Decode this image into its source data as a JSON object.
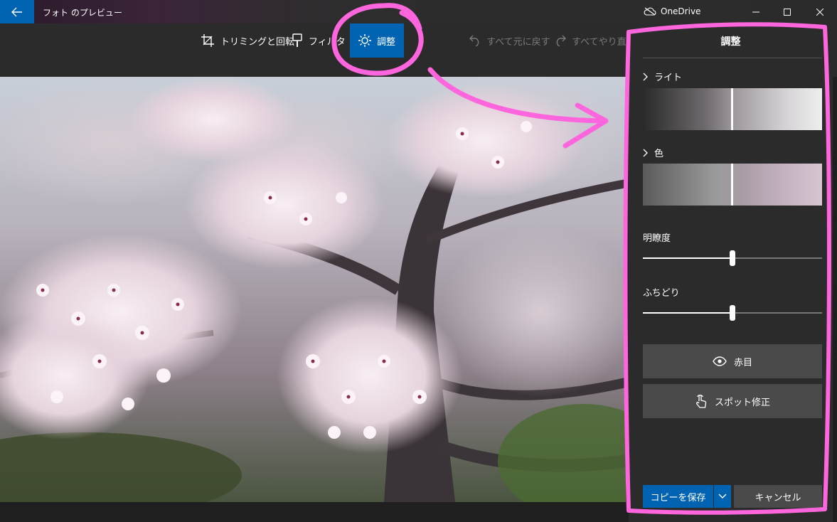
{
  "titlebar": {
    "app_title": "フォト のプレビュー",
    "onedrive_label": "OneDrive"
  },
  "toolbar": {
    "crop": "トリミングと回転",
    "filter": "フィルタ",
    "adjust": "調整",
    "undo_all": "すべて元に戻す",
    "redo_all": "すべてやり直す"
  },
  "panel": {
    "title": "調整",
    "light_label": "ライト",
    "color_label": "色",
    "clarity_label": "明瞭度",
    "vignette_label": "ふちどり",
    "clarity_value": 0.5,
    "vignette_value": 0.5,
    "redeye_label": "赤目",
    "spotfix_label": "スポット修正",
    "save_copy_label": "コピーを保存",
    "cancel_label": "キャンセル"
  },
  "colors": {
    "accent": "#0063b1",
    "annotation": "#ff66dd",
    "panel_bg": "#2b2b2b",
    "button_bg": "#4a4a4a"
  }
}
